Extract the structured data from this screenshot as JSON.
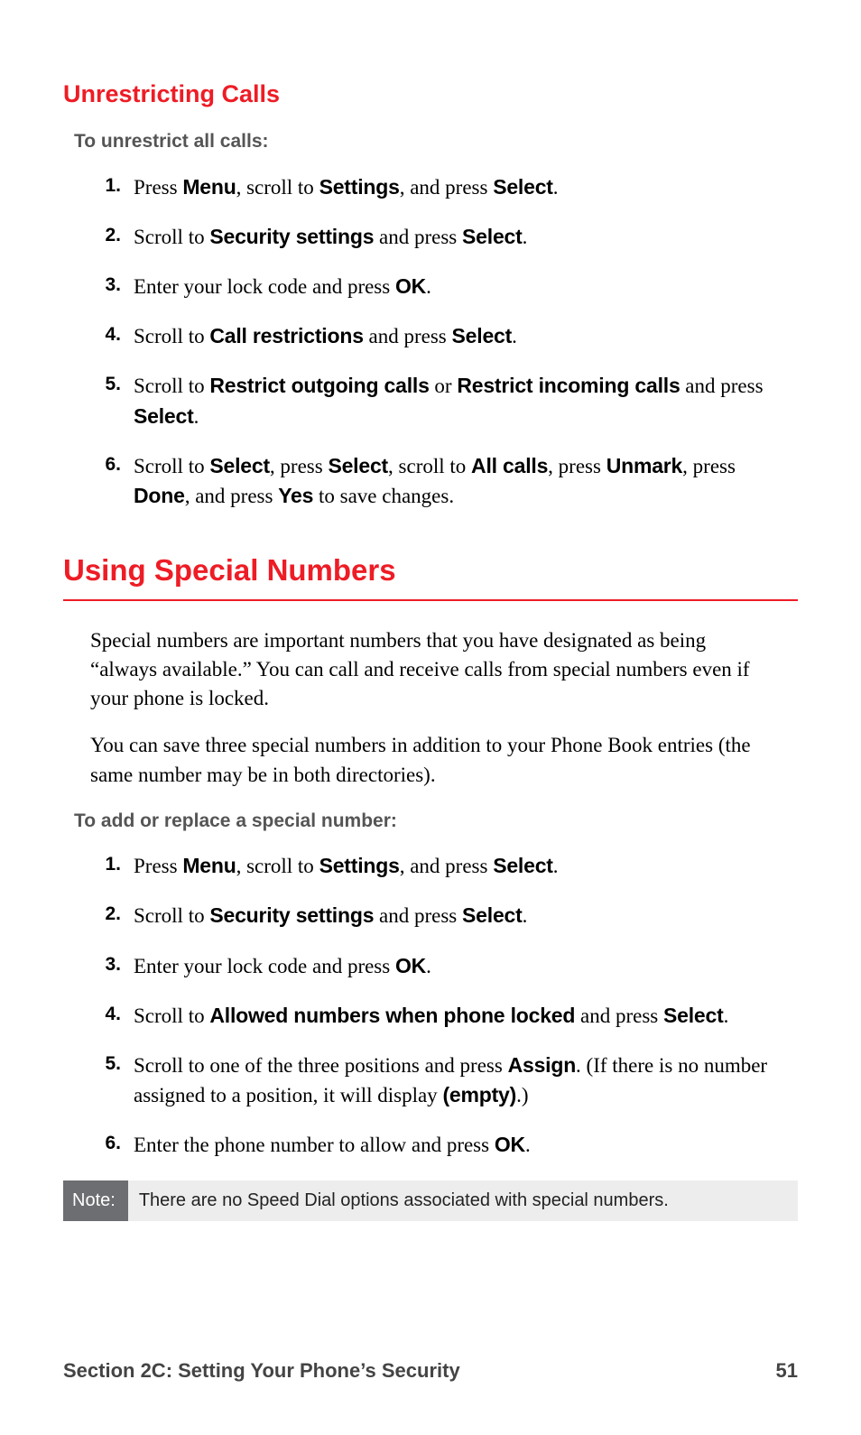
{
  "section1": {
    "heading": "Unrestricting Calls",
    "lead": "To unrestrict all calls:",
    "steps": [
      {
        "n": "1.",
        "parts": [
          "Press ",
          "Menu",
          ", scroll to ",
          "Settings",
          ", and press ",
          "Select",
          "."
        ]
      },
      {
        "n": "2.",
        "parts": [
          "Scroll to ",
          "Security settings",
          " and press ",
          "Select",
          "."
        ]
      },
      {
        "n": "3.",
        "parts": [
          "Enter your lock code and press ",
          "OK",
          "."
        ]
      },
      {
        "n": "4.",
        "parts": [
          "Scroll to ",
          "Call restrictions",
          " and press ",
          "Select",
          "."
        ]
      },
      {
        "n": "5.",
        "parts": [
          "Scroll to ",
          "Restrict outgoing calls",
          " or ",
          "Restrict incoming calls",
          " and press ",
          "Select",
          "."
        ]
      },
      {
        "n": "6.",
        "parts": [
          "Scroll to ",
          "Select",
          ", press ",
          "Select",
          ", scroll to ",
          "All calls",
          ", press ",
          "Unmark",
          ", press ",
          "Done",
          ", and press ",
          "Yes",
          " to save changes."
        ]
      }
    ]
  },
  "section2": {
    "heading": "Using Special Numbers",
    "para1": "Special numbers are important numbers that you have designated as being “always available.” You can call and receive calls from special numbers even if your phone is locked.",
    "para2": "You can save three special numbers in addition to your Phone Book entries (the same number may be in both directories).",
    "lead": "To add or replace a special number:",
    "steps": [
      {
        "n": "1.",
        "parts": [
          "Press ",
          "Menu",
          ", scroll to ",
          "Settings",
          ", and press ",
          "Select",
          "."
        ]
      },
      {
        "n": "2.",
        "parts": [
          "Scroll to ",
          "Security settings",
          " and press ",
          "Select",
          "."
        ]
      },
      {
        "n": "3.",
        "parts": [
          "Enter your lock code and press ",
          "OK",
          "."
        ]
      },
      {
        "n": "4.",
        "parts": [
          "Scroll to ",
          "Allowed numbers when phone locked",
          " and press ",
          "Select",
          "."
        ]
      },
      {
        "n": "5.",
        "parts": [
          "Scroll to one of the three positions and press ",
          "Assign",
          ". (If there is no number assigned to a position, it will display ",
          "(empty)",
          ".)"
        ]
      },
      {
        "n": "6.",
        "parts": [
          "Enter the phone number to allow and press ",
          "OK",
          "."
        ]
      }
    ],
    "note_label": "Note:",
    "note_text": "There are no Speed Dial options associated with special numbers."
  },
  "footer": {
    "left": "Section 2C: Setting Your Phone’s Security",
    "right": "51"
  }
}
